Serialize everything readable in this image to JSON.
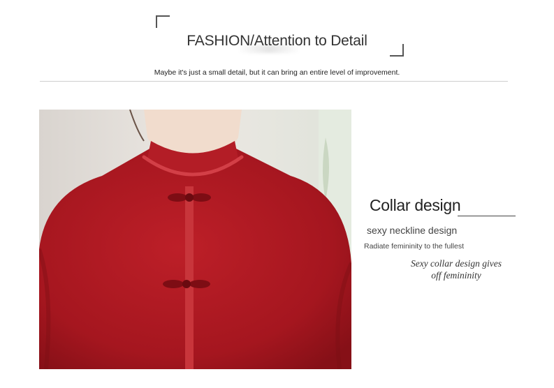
{
  "header": {
    "title": "FASHION/Attention to Detail",
    "subtitle": "Maybe it's just a small detail, but it can bring an entire level of improvement."
  },
  "feature": {
    "title": "Collar design",
    "subtitle": "sexy neckline design",
    "description": "Radiate femininity to the fullest",
    "italic_line1": "Sexy collar design gives",
    "italic_line2": "off femininity"
  },
  "photo": {
    "subject": "red-knit-sweater-mock-neck",
    "colors": {
      "sweater": "#b01a22",
      "sweater_shadow": "#8e1119",
      "background": "#e6e2dd",
      "skin": "#f1dccd"
    }
  }
}
